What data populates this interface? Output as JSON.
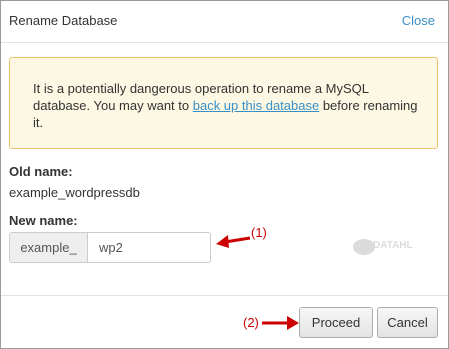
{
  "dialog": {
    "title": "Rename Database",
    "close_label": "Close"
  },
  "warning": {
    "text_before": "It is a potentially dangerous operation to rename a MySQL database. You may want to ",
    "link_text": "back up this database",
    "text_after": " before renaming it."
  },
  "old_name": {
    "label": "Old name:",
    "value": "example_wordpressdb"
  },
  "new_name": {
    "label": "New name:",
    "prefix": "example_",
    "value": "wp2"
  },
  "annotations": {
    "step1": "(1)",
    "step2": "(2)",
    "color": "#cc0000"
  },
  "buttons": {
    "proceed": "Proceed",
    "cancel": "Cancel"
  },
  "watermark_text": "DATAHL"
}
